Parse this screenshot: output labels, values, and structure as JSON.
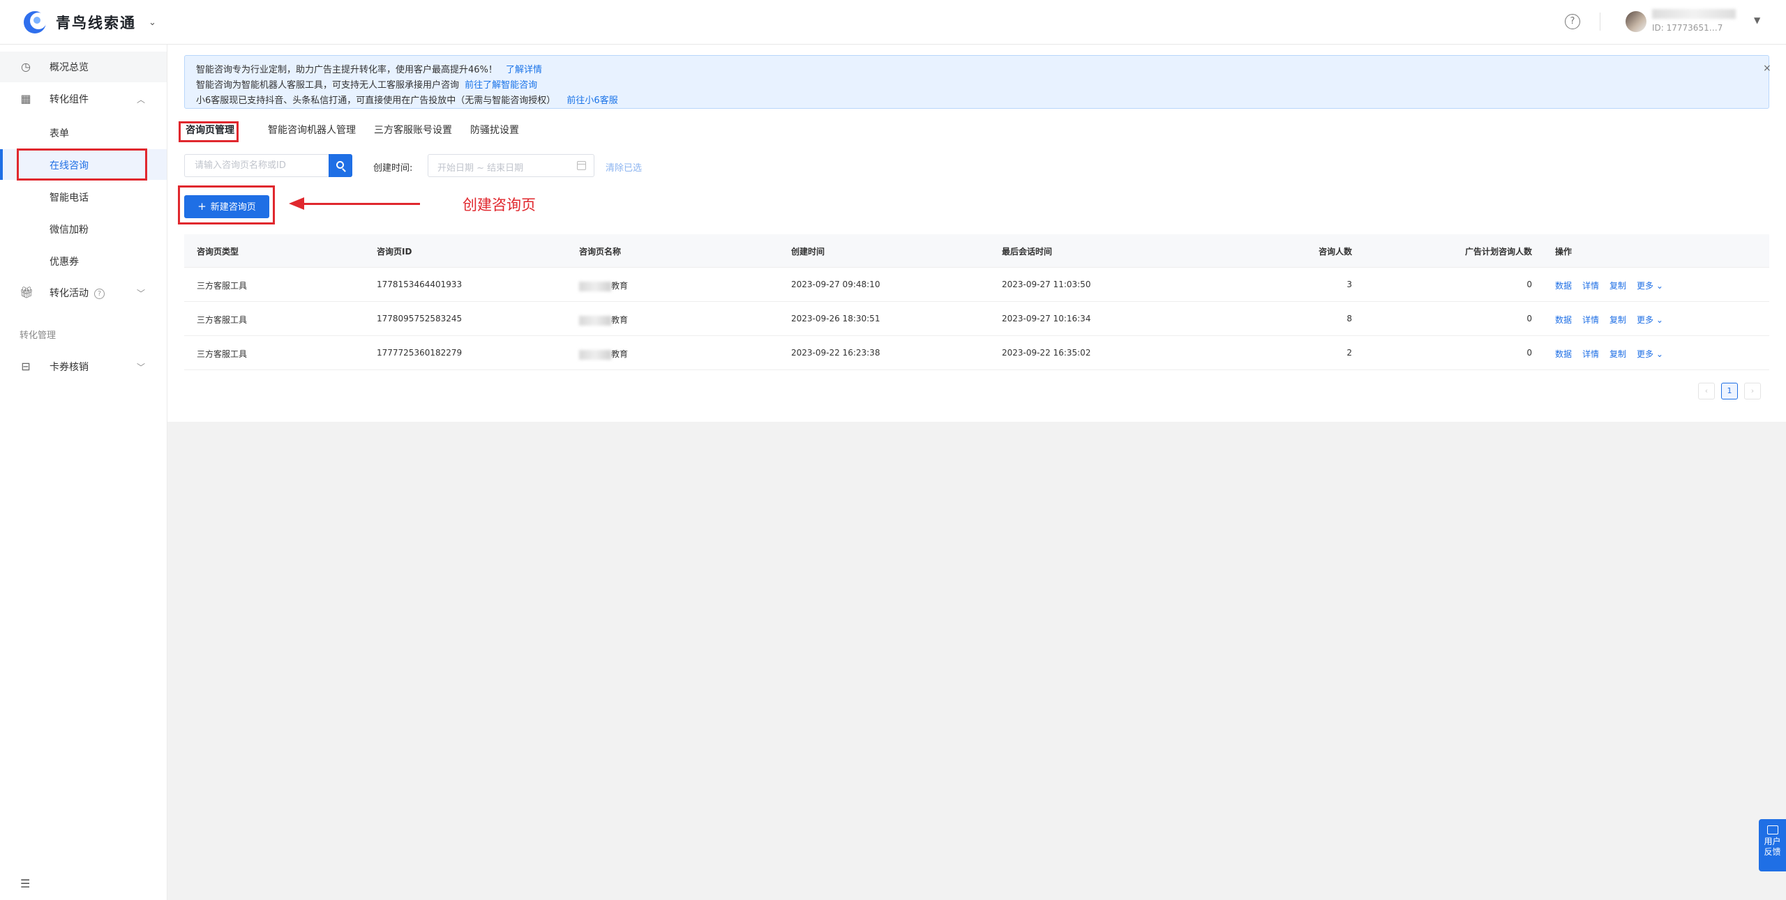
{
  "header": {
    "app_name": "青鸟线索通",
    "help_icon": "question-circle-icon",
    "user_id": "ID: 17773651…7"
  },
  "sidebar": {
    "items": [
      {
        "label": "概况总览",
        "icon": "pie-chart-icon"
      },
      {
        "label": "转化组件",
        "icon": "grid-icon",
        "expanded": true
      },
      {
        "label": "转化活动",
        "icon": "gift-icon"
      },
      {
        "label": "卡券核销",
        "icon": "ticket-icon"
      }
    ],
    "sub_items": [
      {
        "label": "表单"
      },
      {
        "label": "在线咨询",
        "active": true
      },
      {
        "label": "智能电话"
      },
      {
        "label": "微信加粉"
      },
      {
        "label": "优惠券"
      }
    ],
    "group_title": "转化管理",
    "help_mark": "?",
    "collapse_icon": "menu-fold-icon"
  },
  "notice": {
    "line1": "智能咨询专为行业定制，助力广告主提升转化率，使用客户最高提升46%！",
    "line1_link": "了解详情",
    "line2": "智能咨询为智能机器人客服工具，可支持无人工客服承接用户咨询",
    "line2_link": "前往了解智能咨询",
    "line3": "小6客服现已支持抖音、头条私信打通，可直接使用在广告投放中（无需与智能咨询授权）",
    "line3_link": "前往小6客服",
    "close": "×"
  },
  "tabs": [
    {
      "label": "咨询页管理",
      "active": true
    },
    {
      "label": "智能咨询机器人管理"
    },
    {
      "label": "三方客服账号设置"
    },
    {
      "label": "防骚扰设置"
    }
  ],
  "filters": {
    "search_placeholder": "请输入咨询页名称或ID",
    "date_label": "创建时间:",
    "date_placeholder": "开始日期 ~ 结束日期",
    "clear_label": "清除已选"
  },
  "create_button": {
    "plus": "+",
    "label": "新建咨询页"
  },
  "annotation": {
    "text": "创建咨询页",
    "color": "#e0282e"
  },
  "table": {
    "columns": [
      "咨询页类型",
      "咨询页ID",
      "咨询页名称",
      "创建时间",
      "最后会话时间",
      "咨询人数",
      "广告计划咨询人数",
      "操作"
    ],
    "rows": [
      {
        "type": "三方客服工具",
        "id": "1778153464401933",
        "name_suffix": "教育",
        "created": "2023-09-27 09:48:10",
        "last": "2023-09-27 11:03:50",
        "count": "3",
        "ad_count": "0"
      },
      {
        "type": "三方客服工具",
        "id": "1778095752583245",
        "name_suffix": "教育",
        "created": "2023-09-26 18:30:51",
        "last": "2023-09-27 10:16:34",
        "count": "8",
        "ad_count": "0"
      },
      {
        "type": "三方客服工具",
        "id": "1777725360182279",
        "name_suffix": "教育",
        "created": "2023-09-22 16:23:38",
        "last": "2023-09-22 16:35:02",
        "count": "2",
        "ad_count": "0"
      }
    ],
    "ops": [
      "数据",
      "详情",
      "复制",
      "更多"
    ]
  },
  "pagination": {
    "prev": "‹",
    "current": "1",
    "next": "›"
  },
  "feedback": {
    "label": "用户反馈",
    "icon": "message-icon"
  },
  "colors": {
    "primary": "#1f6fe5",
    "annotation": "#e0282e",
    "notice_bg": "#e8f2ff"
  }
}
